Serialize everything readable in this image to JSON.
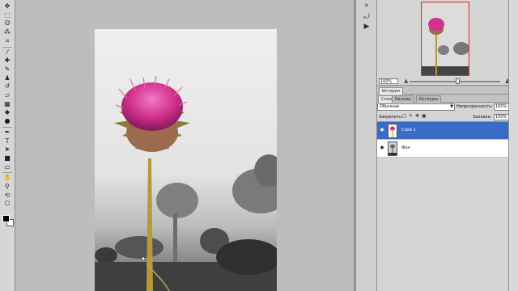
{
  "colors": {
    "workspace": "#bdbdbd",
    "panel": "#d5d5d5",
    "selection": "#3a6bc6",
    "flower": "#d2328e",
    "stem": "#b49a3a"
  },
  "tools": [
    {
      "icon": "move-icon",
      "glyph": "✥"
    },
    {
      "icon": "marquee-icon",
      "glyph": "⬚"
    },
    {
      "icon": "lasso-icon",
      "glyph": "ʘ"
    },
    {
      "icon": "magic-wand-icon",
      "glyph": "⁂"
    },
    {
      "icon": "crop-icon",
      "glyph": "⌗"
    },
    {
      "icon": "eyedropper-icon",
      "glyph": "⁄"
    },
    {
      "icon": "healing-brush-icon",
      "glyph": "✚"
    },
    {
      "icon": "brush-icon",
      "glyph": "✎"
    },
    {
      "icon": "clone-stamp-icon",
      "glyph": "♟"
    },
    {
      "icon": "history-brush-icon",
      "glyph": "↺"
    },
    {
      "icon": "eraser-icon",
      "glyph": "▱"
    },
    {
      "icon": "gradient-icon",
      "glyph": "▦"
    },
    {
      "icon": "blur-icon",
      "glyph": "◆"
    },
    {
      "icon": "dodge-icon",
      "glyph": "●"
    },
    {
      "icon": "pen-icon",
      "glyph": "✒"
    },
    {
      "icon": "type-icon",
      "glyph": "T"
    },
    {
      "icon": "path-selection-icon",
      "glyph": "➤"
    },
    {
      "icon": "rectangle-shape-icon",
      "glyph": "■"
    },
    {
      "icon": "notes-icon",
      "glyph": "▭"
    },
    {
      "icon": "hand-icon",
      "glyph": "✋"
    },
    {
      "icon": "zoom-icon",
      "glyph": "⚲"
    },
    {
      "icon": "rotate-view-icon",
      "glyph": "⟲"
    },
    {
      "icon": "3d-icon",
      "glyph": "⬡"
    }
  ],
  "navigator": {
    "zoom": "100%"
  },
  "history_tabs": [
    "История"
  ],
  "layers_tabs": [
    "Слои",
    "Каналы",
    "Контуры"
  ],
  "layers": {
    "blend_mode": "Обычные",
    "opacity_label": "Непрозрачность:",
    "opacity": "100%",
    "lock_label": "Закрепить:",
    "fill_label": "Заливка:",
    "fill": "100%",
    "items": [
      {
        "name": "Слой 1",
        "selected": true
      },
      {
        "name": "Фон",
        "selected": false
      }
    ]
  }
}
